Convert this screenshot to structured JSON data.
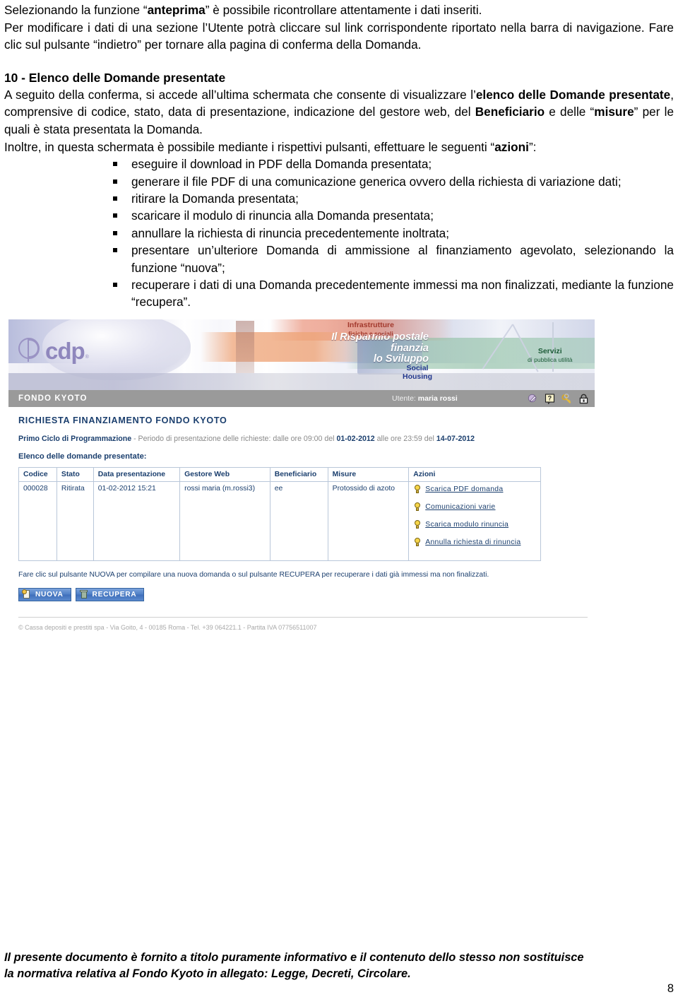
{
  "document": {
    "intro_paragraphs": [
      {
        "segments": [
          {
            "text": "Selezionando la funzione “",
            "bold": false
          },
          {
            "text": "anteprima",
            "bold": true
          },
          {
            "text": "” è possibile ricontrollare attentamente i dati inseriti.",
            "bold": false
          }
        ]
      },
      {
        "segments": [
          {
            "text": "Per modificare i dati di una sezione l’Utente potrà cliccare sul link corrispondente riportato nella barra di navigazione. Fare clic sul pulsante “indietro” per tornare alla pagina di conferma della Domanda.",
            "bold": false
          }
        ]
      }
    ],
    "section_heading": "10 - Elenco delle Domande presentate",
    "section_paragraphs": [
      {
        "segments": [
          {
            "text": "A seguito della conferma, si accede all’ultima schermata che consente di visualizzare l’",
            "bold": false
          },
          {
            "text": "elenco delle Domande presentate",
            "bold": true
          },
          {
            "text": ", comprensive di codice, stato, data di presentazione, indicazione del gestore web, del ",
            "bold": false
          },
          {
            "text": "Beneficiario",
            "bold": true
          },
          {
            "text": " e delle “",
            "bold": false
          },
          {
            "text": "misure",
            "bold": true
          },
          {
            "text": "” per le quali è stata presentata la Domanda.",
            "bold": false
          }
        ]
      },
      {
        "segments": [
          {
            "text": "Inoltre, in questa schermata è possibile mediante i rispettivi pulsanti, effettuare le seguenti “",
            "bold": false
          },
          {
            "text": "azioni",
            "bold": true
          },
          {
            "text": "”:",
            "bold": false
          }
        ]
      }
    ],
    "bullets": [
      "eseguire il download in PDF della Domanda presentata;",
      "generare il file PDF di una comunicazione generica ovvero della richiesta di variazione dati;",
      "ritirare la Domanda presentata;",
      "scaricare il modulo di rinuncia alla Domanda presentata;",
      "annullare la richiesta di rinuncia precedentemente inoltrata;",
      "presentare un’ulteriore Domanda di ammissione al finanziamento agevolato, selezionando la funzione “nuova”;",
      "recuperare i dati di una Domanda precedentemente immessi ma non finalizzati, mediante la funzione “recupera”."
    ],
    "footer_line1": "Il presente documento è fornito a titolo puramente informativo e il contenuto dello stesso non sostituisce",
    "footer_line2": "la normativa relativa al Fondo Kyoto in allegato: Legge, Decreti, Circolare.",
    "page_number": "8"
  },
  "screenshot": {
    "banner": {
      "logo_word": "cdp",
      "logo_tm": "®",
      "slogan_line1": "Il Risparmio postale",
      "slogan_line2": "finanzia",
      "slogan_line3": "lo Sviluppo",
      "tag_infrastrutture_1": "Infrastrutture",
      "tag_infrastrutture_2": "fisiche e sociali",
      "tag_social_1": "Social",
      "tag_social_2": "Housing",
      "tag_servizi_1": "Servizi",
      "tag_servizi_2": "di pubblica utilità"
    },
    "userbar": {
      "section_label": "FONDO KYOTO",
      "user_prefix": "Utente: ",
      "user_name": "maria rossi",
      "icons": [
        "edit-pen-icon",
        "help-question-icon",
        "keys-icon",
        "lock-exit-icon"
      ]
    },
    "app": {
      "title": "RICHIESTA FINANZIAMENTO FONDO KYOTO",
      "subtitle_lead": "Primo Ciclo di Programmazione",
      "subtitle_mid": " - Periodo di presentazione delle richieste: dalle ore 09:00 del ",
      "subtitle_date1": "01-02-2012",
      "subtitle_mid2": " alle ore 23:59 del ",
      "subtitle_date2": "14-07-2012",
      "list_label": "Elenco delle domande presentate:",
      "table": {
        "headers": [
          "Codice",
          "Stato",
          "Data presentazione",
          "Gestore Web",
          "Beneficiario",
          "Misure",
          "Azioni"
        ],
        "rows": [
          {
            "codice": "000028",
            "stato": "Ritirata",
            "data": "01-02-2012 15:21",
            "gestore": "rossi maria (m.rossi3)",
            "beneficiario": "ee",
            "misure": "Protossido di azoto",
            "azioni": [
              "Scarica PDF domanda",
              "Comunicazioni varie",
              "Scarica modulo rinuncia",
              "Annulla richiesta di rinuncia"
            ]
          }
        ]
      },
      "hint": "Fare clic sul pulsante NUOVA per compilare una nuova domanda o sul pulsante RECUPERA per recuperare i dati già immessi ma non finalizzati.",
      "buttons": [
        {
          "label": "NUOVA",
          "icon": "new-document-icon"
        },
        {
          "label": "RECUPERA",
          "icon": "recycle-bin-icon"
        }
      ],
      "footer": "© Cassa depositi e prestiti spa - Via Goito, 4 - 00185 Roma - Tel. +39 064221.1 - Partita IVA 07756511007"
    }
  }
}
